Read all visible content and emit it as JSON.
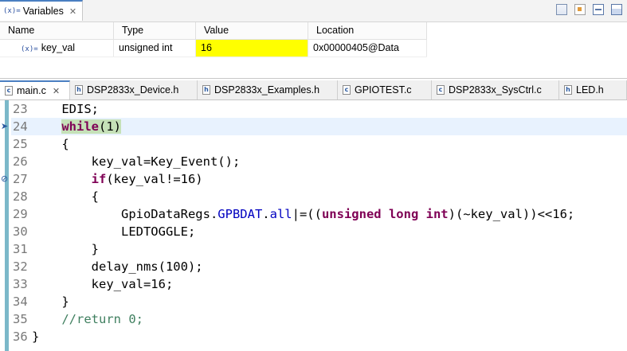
{
  "variables_view": {
    "tab_label": "Variables",
    "tab_icon": "(x)=",
    "columns": [
      "Name",
      "Type",
      "Value",
      "Location"
    ],
    "rows": [
      {
        "icon": "(x)=",
        "name": "key_val",
        "type": "unsigned int",
        "value": "16",
        "location": "0x00000405@Data",
        "value_highlight": "#ffff00"
      }
    ]
  },
  "editor_tabs": [
    {
      "icon": "c",
      "label": "main.c",
      "active": true
    },
    {
      "icon": "h",
      "label": "DSP2833x_Device.h"
    },
    {
      "icon": "h",
      "label": "DSP2833x_Examples.h"
    },
    {
      "icon": "c",
      "label": "GPIOTEST.c"
    },
    {
      "icon": "c",
      "label": "DSP2833x_SysCtrl.c"
    },
    {
      "icon": "h",
      "label": "LED.h"
    }
  ],
  "code_lines": [
    {
      "num": "23",
      "text": "    EDIS;"
    },
    {
      "num": "24",
      "text": "    while(1)",
      "current": true
    },
    {
      "num": "25",
      "text": "    {"
    },
    {
      "num": "26",
      "text": "        key_val=Key_Event();"
    },
    {
      "num": "27",
      "text": "        if(key_val!=16)"
    },
    {
      "num": "28",
      "text": "        {"
    },
    {
      "num": "29",
      "text": "            GpioDataRegs.GPBDAT.all|=((unsigned long int)(~key_val))<<16;"
    },
    {
      "num": "30",
      "text": "            LEDTOGGLE;"
    },
    {
      "num": "31",
      "text": "        }"
    },
    {
      "num": "32",
      "text": "        delay_nms(100);"
    },
    {
      "num": "33",
      "text": "        key_val=16;"
    },
    {
      "num": "34",
      "text": "    }"
    },
    {
      "num": "35",
      "text": "    //return 0;"
    },
    {
      "num": "36",
      "text": "}"
    }
  ],
  "colors": {
    "keyword": "#7f0055",
    "field": "#0000c0",
    "comment": "#3f7f5f",
    "current_line": "#e8f2fe",
    "statement_highlight": "#c5e1b8"
  },
  "icons": {
    "variable": "variable-icon",
    "close": "close-icon",
    "c_file": "c-file-icon",
    "h_file": "h-file-icon",
    "debug_pointer": "instruction-pointer-icon",
    "breakpoint": "breakpoint-icon"
  }
}
